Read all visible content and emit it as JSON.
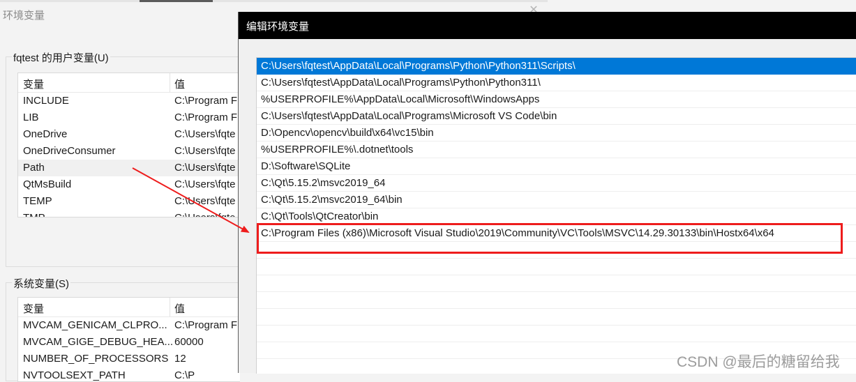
{
  "bg_window": {
    "title": "环境变量",
    "close_glyph": "✕",
    "user_vars": {
      "group_label": "fqtest 的用户变量(U)",
      "col_name": "变量",
      "col_value": "值",
      "rows": [
        {
          "name": "INCLUDE",
          "value": "C:\\Program F"
        },
        {
          "name": "LIB",
          "value": "C:\\Program F"
        },
        {
          "name": "OneDrive",
          "value": "C:\\Users\\fqte"
        },
        {
          "name": "OneDriveConsumer",
          "value": "C:\\Users\\fqte"
        },
        {
          "name": "Path",
          "value": "C:\\Users\\fqte"
        },
        {
          "name": "QtMsBuild",
          "value": "C:\\Users\\fqte"
        },
        {
          "name": "TEMP",
          "value": "C:\\Users\\fqte"
        },
        {
          "name": "TMP",
          "value": "C:\\Users\\fqte"
        }
      ]
    },
    "system_vars": {
      "group_label": "系统变量(S)",
      "col_name": "变量",
      "col_value": "值",
      "rows": [
        {
          "name": "MVCAM_GENICAM_CLPRO...",
          "value": "C:\\Program F"
        },
        {
          "name": "MVCAM_GIGE_DEBUG_HEA...",
          "value": "60000"
        },
        {
          "name": "NUMBER_OF_PROCESSORS",
          "value": "12"
        },
        {
          "name": "NVTOOLSEXT_PATH",
          "value": "C:\\P"
        }
      ]
    }
  },
  "dialog": {
    "title": "编辑环境变量",
    "paths": [
      "C:\\Users\\fqtest\\AppData\\Local\\Programs\\Python\\Python311\\Scripts\\",
      "C:\\Users\\fqtest\\AppData\\Local\\Programs\\Python\\Python311\\",
      "%USERPROFILE%\\AppData\\Local\\Microsoft\\WindowsApps",
      "C:\\Users\\fqtest\\AppData\\Local\\Programs\\Microsoft VS Code\\bin",
      "D:\\Opencv\\opencv\\build\\x64\\vc15\\bin",
      "%USERPROFILE%\\.dotnet\\tools",
      "D:\\Software\\SQLite",
      "C:\\Qt\\5.15.2\\msvc2019_64",
      "C:\\Qt\\5.15.2\\msvc2019_64\\bin",
      "C:\\Qt\\Tools\\QtCreator\\bin",
      "C:\\Program Files (x86)\\Microsoft Visual Studio\\2019\\Community\\VC\\Tools\\MSVC\\14.29.30133\\bin\\Hostx64\\x64",
      "",
      "",
      "",
      "",
      "",
      "",
      ""
    ]
  },
  "annotation": {
    "color": "#ee1c1c"
  },
  "watermark": "CSDN @最后的糖留给我"
}
